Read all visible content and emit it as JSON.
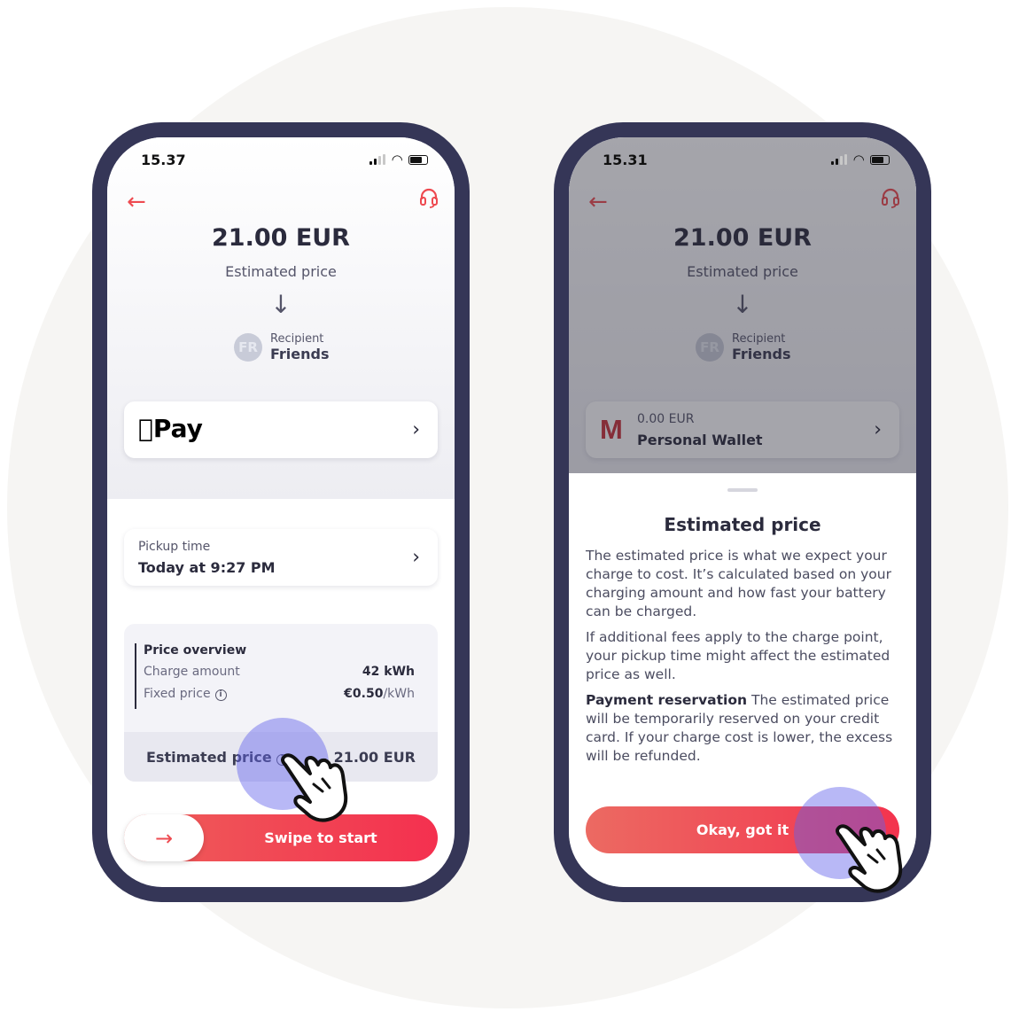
{
  "left_phone": {
    "status": {
      "time": "15.37"
    },
    "header": {
      "amount": "21.00 EUR",
      "amount_label": "Estimated price"
    },
    "recipient": {
      "initials": "FR",
      "label": "Recipient",
      "name": "Friends"
    },
    "payment": {
      "method": "Pay"
    },
    "pickup": {
      "label": "Pickup time",
      "value": "Today at 9:27 PM"
    },
    "price_overview": {
      "title": "Price overview",
      "rows": [
        {
          "label": "Charge amount",
          "value": "42 kWh"
        },
        {
          "label": "Fixed price",
          "value_bold": "€0.50",
          "value_unit": "/kWh"
        }
      ],
      "estimated_label": "Estimated price",
      "estimated_value": "21.00 EUR"
    },
    "swipe": {
      "label": "Swipe to start"
    }
  },
  "right_phone": {
    "status": {
      "time": "15.31"
    },
    "header": {
      "amount": "21.00 EUR",
      "amount_label": "Estimated price"
    },
    "recipient": {
      "initials": "FR",
      "label": "Recipient",
      "name": "Friends"
    },
    "wallet": {
      "logo": "M",
      "balance": "0.00 EUR",
      "name": "Personal Wallet"
    },
    "sheet": {
      "title": "Estimated price",
      "p1": "The estimated price is what we expect your charge to cost. It’s calculated based on your charging amount and how fast your battery can be charged.",
      "p2": "If additional fees apply to the charge point, your pickup time might affect the estimated price as well.",
      "p3_bold": "Payment reservation",
      "p3": " The estimated price will be temporarily reserved on your credit card. If your charge cost is lower, the excess will be refunded.",
      "button": "Okay, got it"
    }
  },
  "colors": {
    "accent": "#ee4a50",
    "frame": "#353657",
    "tap": "#6262eb",
    "background": "#f6f5f3"
  }
}
